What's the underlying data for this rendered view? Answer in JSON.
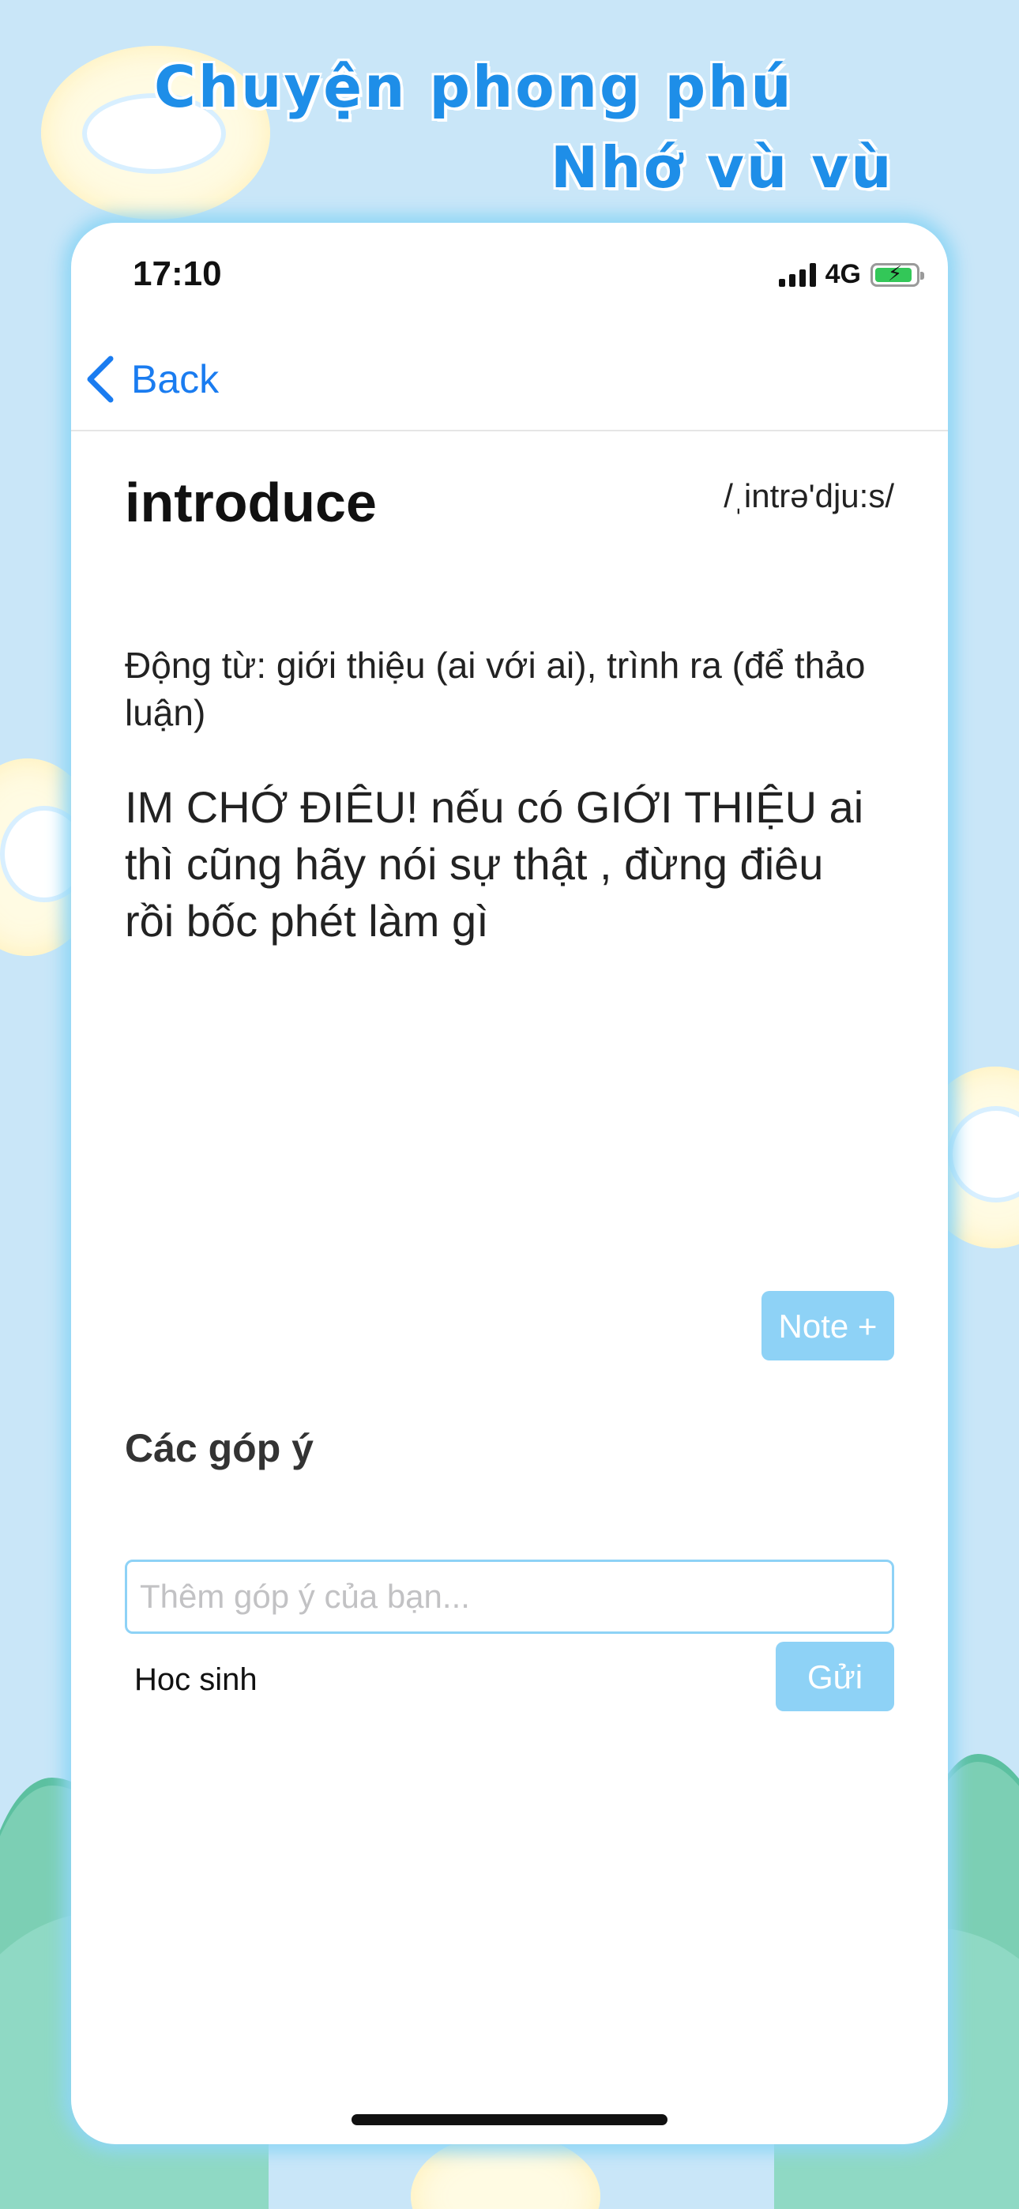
{
  "promo": {
    "line1": "Chuyện phong phú",
    "line2": "Nhớ vù vù"
  },
  "status_bar": {
    "time": "17:10",
    "network": "4G",
    "battery_charging": true
  },
  "nav": {
    "back_label": "Back"
  },
  "entry": {
    "word": "introduce",
    "ipa": "/ˌintrə'dju:s/",
    "definition": "Động từ: giới thiệu (ai với ai), trình ra (để thảo luận)",
    "example": "IM CHỚ ĐIÊU! nếu có GIỚI THIỆU ai thì cũng hãy nói sự thật , đừng điêu rồi bốc phét làm gì"
  },
  "note_button_label": "Note +",
  "comments": {
    "title": "Các góp ý",
    "input_placeholder": "Thêm góp ý của bạn...",
    "input_value": "",
    "commenter_name": "Hoc sinh",
    "send_label": "Gửi"
  },
  "icons": {
    "back": "chevron-left-icon",
    "signal": "cellular-signal-icon",
    "battery": "battery-charging-icon",
    "prev": "arrow-left-circle-icon",
    "next": "arrow-right-circle-icon"
  },
  "colors": {
    "accent": "#1a7cf0",
    "button": "#8ed2f6",
    "background": "#c9e6f8",
    "headline": "#1e8ee8"
  }
}
